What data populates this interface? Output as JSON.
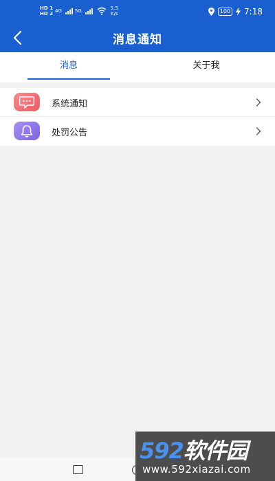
{
  "status_bar": {
    "hd_top": "HD 1",
    "hd_bottom": "HD 2",
    "network_1": "4G",
    "network_2": "5G",
    "speed_value": "5.5",
    "speed_unit": "K/s",
    "battery": "100",
    "time": "7:18",
    "icons": [
      "signal-icon",
      "wifi-icon",
      "location-icon",
      "battery-icon",
      "charging-icon"
    ]
  },
  "header": {
    "title": "消息通知",
    "back_icon": "back-arrow-icon"
  },
  "tabs": [
    {
      "label": "消息",
      "active": true
    },
    {
      "label": "关于我",
      "active": false
    }
  ],
  "list": [
    {
      "label": "系统通知",
      "icon": "message-icon",
      "color": "#ee5b63"
    },
    {
      "label": "处罚公告",
      "icon": "bell-icon",
      "color": "#7b62e3"
    }
  ],
  "watermark": {
    "logo_num": "592",
    "logo_text": "软件园",
    "url": "www.592xiazai.com"
  },
  "colors": {
    "primary": "#1a5fcf",
    "background": "#f1f1f1"
  }
}
